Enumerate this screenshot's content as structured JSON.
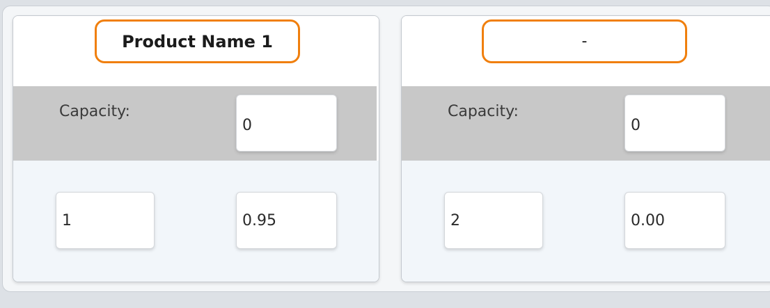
{
  "cards": [
    {
      "product_name": "Product Name 1",
      "capacity_label": "Capacity:",
      "capacity_value": "0",
      "left_value": "1",
      "right_value": "0.95"
    },
    {
      "product_name": "-",
      "capacity_label": "Capacity:",
      "capacity_value": "0",
      "left_value": "2",
      "right_value": "0.00"
    }
  ],
  "colors": {
    "highlight_border": "#f07f0d",
    "capacity_band": "#c8c8c8",
    "bottom_band": "#f2f6fa",
    "page_background": "#dde1e6"
  }
}
